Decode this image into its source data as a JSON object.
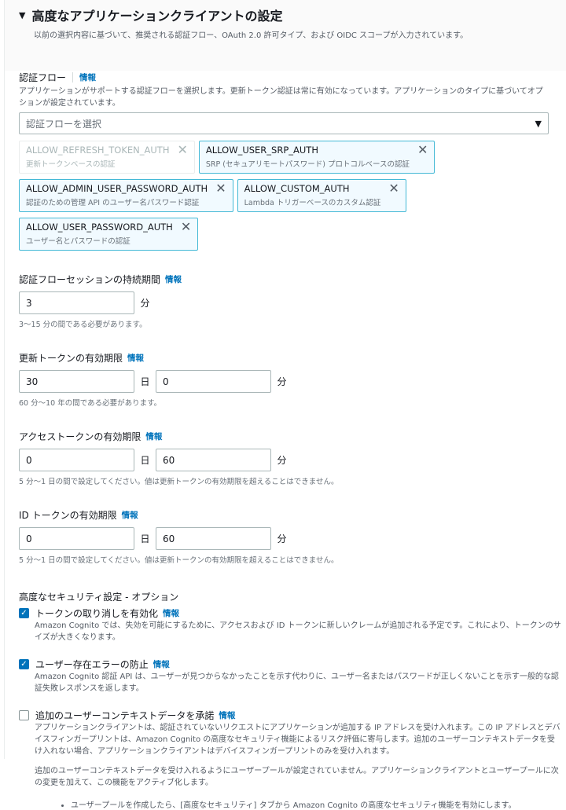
{
  "header": {
    "title": "高度なアプリケーションクライアントの設定",
    "subtitle": "以前の選択内容に基づいて、推奨される認証フロー、OAuth 2.0 許可タイプ、および OIDC スコープが入力されています。"
  },
  "info": "情報",
  "auth_flow": {
    "label": "認証フロー",
    "description": "アプリケーションがサポートする認証フローを選択します。更新トークン認証は常に有効になっています。アプリケーションのタイプに基づいてオプションが設定されています。",
    "placeholder": "認証フローを選択",
    "tokens": [
      {
        "name": "ALLOW_REFRESH_TOKEN_AUTH",
        "desc": "更新トークンベースの認証",
        "disabled": true
      },
      {
        "name": "ALLOW_USER_SRP_AUTH",
        "desc": "SRP (セキュアリモートパスワード) プロトコルベースの認証"
      },
      {
        "name": "ALLOW_ADMIN_USER_PASSWORD_AUTH",
        "desc": "認証のための管理 API のユーザー名パスワード認証"
      },
      {
        "name": "ALLOW_CUSTOM_AUTH",
        "desc": "Lambda トリガーベースのカスタム認証"
      },
      {
        "name": "ALLOW_USER_PASSWORD_AUTH",
        "desc": "ユーザー名とパスワードの認証"
      }
    ]
  },
  "session": {
    "label": "認証フローセッションの持続期間",
    "value": "3",
    "unit": "分",
    "hint": "3〜15 分の間である必要があります。"
  },
  "refresh": {
    "label": "更新トークンの有効期限",
    "value1": "30",
    "unit1": "日",
    "value2": "0",
    "unit2": "分",
    "hint": "60 分〜10 年の間である必要があります。"
  },
  "access": {
    "label": "アクセストークンの有効期限",
    "value1": "0",
    "unit1": "日",
    "value2": "60",
    "unit2": "分",
    "hint": "5 分〜1 日の間で設定してください。値は更新トークンの有効期限を超えることはできません。"
  },
  "idtoken": {
    "label": "ID トークンの有効期限",
    "value1": "0",
    "unit1": "日",
    "value2": "60",
    "unit2": "分",
    "hint": "5 分〜1 日の間で設定してください。値は更新トークンの有効期限を超えることはできません。"
  },
  "security": {
    "heading": "高度なセキュリティ設定 - オプション",
    "options": [
      {
        "label": "トークンの取り消しを有効化",
        "checked": true,
        "desc": "Amazon Cognito では、失効を可能にするために、アクセスおよび ID トークンに新しいクレームが追加される予定です。これにより、トークンのサイズが大きくなります。"
      },
      {
        "label": "ユーザー存在エラーの防止",
        "checked": true,
        "desc": "Amazon Cognito 認証 API は、ユーザーが見つからなかったことを示す代わりに、ユーザー名またはパスワードが正しくないことを示す一般的な認証失敗レスポンスを返します。"
      },
      {
        "label": "追加のユーザーコンテキストデータを承諾",
        "checked": false,
        "desc": "アプリケーションクライアントは、認証されていないリクエストにアプリケーションが追加する IP アドレスを受け入れます。この IP アドレスとデバイスフィンガープリントは、Amazon Cognito の高度なセキュリティ機能によるリスク評価に寄与します。追加のユーザーコンテキストデータを受け入れない場合、アプリケーションクライアントはデバイスフィンガープリントのみを受け入れます。",
        "note": "追加のユーザーコンテキストデータを受け入れるようにユーザープールが設定されていません。アプリケーションクライアントとユーザープールに次の変更を加えて、この機能をアクティブ化します。",
        "bullet": "ユーザープールを作成したら、[高度なセキュリティ] タブから Amazon Cognito の高度なセキュリティ機能を有効にします。"
      }
    ]
  }
}
